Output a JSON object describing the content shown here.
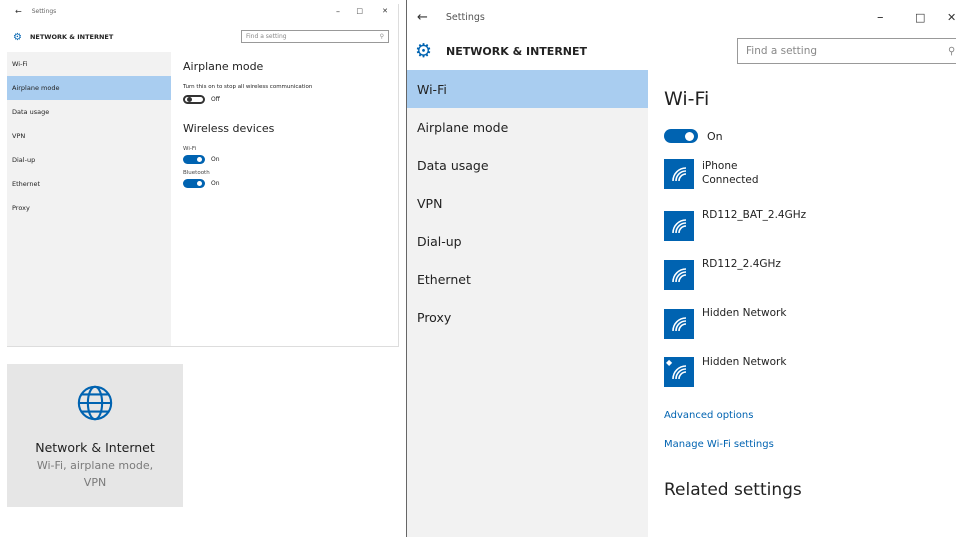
{
  "small_window": {
    "title": "Settings",
    "header": "NETWORK & INTERNET",
    "search_placeholder": "Find a setting",
    "nav": [
      "Wi-Fi",
      "Airplane mode",
      "Data usage",
      "VPN",
      "Dial-up",
      "Ethernet",
      "Proxy"
    ],
    "selected_nav": "Airplane mode",
    "airplane_heading": "Airplane mode",
    "airplane_desc": "Turn this on to stop all wireless communication",
    "airplane_state": "Off",
    "wireless_heading": "Wireless devices",
    "wifi_label": "Wi-Fi",
    "wifi_state": "On",
    "bluetooth_label": "Bluetooth",
    "bluetooth_state": "On"
  },
  "tile": {
    "title": "Network & Internet",
    "subtitle_line1": "Wi-Fi, airplane mode,",
    "subtitle_line2": "VPN"
  },
  "big_window": {
    "title": "Settings",
    "header": "NETWORK & INTERNET",
    "search_placeholder": "Find a setting",
    "nav": [
      "Wi-Fi",
      "Airplane mode",
      "Data usage",
      "VPN",
      "Dial-up",
      "Ethernet",
      "Proxy"
    ],
    "selected_nav": "Wi-Fi",
    "page_title": "Wi-Fi",
    "wifi_state": "On",
    "networks": [
      {
        "name": "iPhone",
        "status": "Connected",
        "secured": false
      },
      {
        "name": "RD112_BAT_2.4GHz",
        "status": "",
        "secured": false
      },
      {
        "name": "RD112_2.4GHz",
        "status": "",
        "secured": false
      },
      {
        "name": "Hidden Network",
        "status": "",
        "secured": false
      },
      {
        "name": "Hidden Network",
        "status": "",
        "secured": true
      }
    ],
    "advanced_link": "Advanced options",
    "manage_link": "Manage Wi-Fi settings",
    "related_heading": "Related settings"
  },
  "colors": {
    "accent": "#0063b1",
    "selected_nav": "#a9cdf0",
    "nav_bg": "#f2f2f2",
    "tile_bg": "#e6e6e6"
  }
}
